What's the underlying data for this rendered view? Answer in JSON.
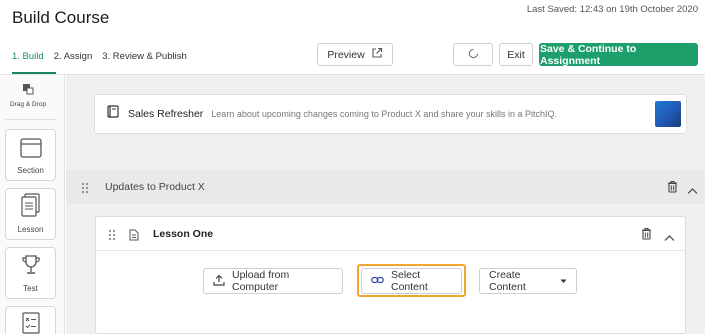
{
  "header": {
    "title": "Build Course",
    "last_saved": "Last Saved: 12:43 on 19th October 2020"
  },
  "tabs": [
    {
      "label": "1. Build",
      "active": true
    },
    {
      "label": "2. Assign",
      "active": false
    },
    {
      "label": "3. Review & Publish",
      "active": false
    }
  ],
  "toolbar": {
    "preview_label": "Preview",
    "exit_label": "Exit",
    "save_label": "Save & Continue to Assignment"
  },
  "sidebar": {
    "drag_drop_label": "Drag & Drop",
    "items": [
      {
        "label": "Section",
        "icon": "section-icon"
      },
      {
        "label": "Lesson",
        "icon": "lesson-icon"
      },
      {
        "label": "Test",
        "icon": "trophy-icon"
      },
      {
        "label": "",
        "icon": "quiz-icon"
      }
    ]
  },
  "course": {
    "name": "Sales Refresher",
    "description": "Learn about upcoming changes coming to Product X and share your skills in a PitchIQ."
  },
  "section": {
    "title": "Updates to Product X"
  },
  "lesson": {
    "title": "Lesson One",
    "upload_label": "Upload from Computer",
    "select_label": "Select Content",
    "create_label": "Create Content"
  },
  "colors": {
    "accent": "#1c9f6a",
    "highlight": "#f2a531"
  }
}
